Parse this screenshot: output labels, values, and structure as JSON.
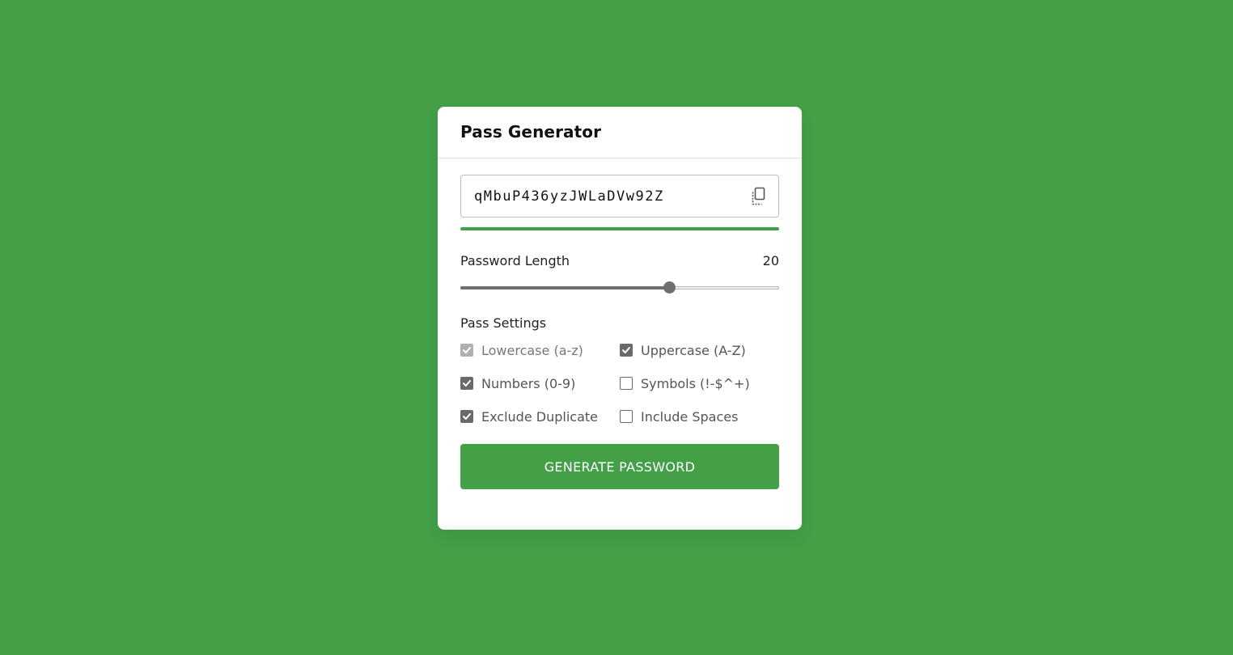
{
  "app": {
    "title": "Pass Generator"
  },
  "password": {
    "value": "qMbuP436yzJWLaDVw92Z",
    "strength_color": "#43a047",
    "strength_percent": 100
  },
  "length": {
    "label": "Password Length",
    "value": "20",
    "min": 1,
    "max": 30,
    "current": 20
  },
  "settings": {
    "title": "Pass Settings",
    "options": [
      {
        "label": "Lowercase (a-z)",
        "checked": true,
        "disabled": true
      },
      {
        "label": "Uppercase (A-Z)",
        "checked": true,
        "disabled": false
      },
      {
        "label": "Numbers (0-9)",
        "checked": true,
        "disabled": false
      },
      {
        "label": "Symbols (!-$^+)",
        "checked": false,
        "disabled": false
      },
      {
        "label": "Exclude Duplicate",
        "checked": true,
        "disabled": false
      },
      {
        "label": "Include Spaces",
        "checked": false,
        "disabled": false
      }
    ]
  },
  "button": {
    "label": "GENERATE PASSWORD"
  },
  "icons": {
    "copy": "copy-icon"
  },
  "colors": {
    "background": "#43a047",
    "accent": "#43a047",
    "card": "#ffffff"
  }
}
